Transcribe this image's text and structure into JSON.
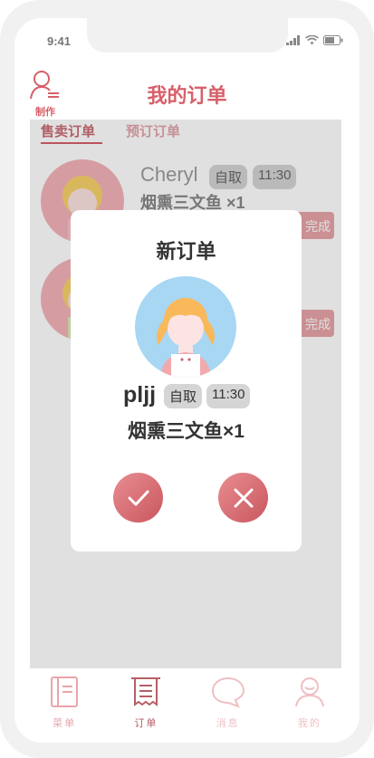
{
  "status_bar": {
    "time": "9:41"
  },
  "header": {
    "make_label": "制作",
    "title": "我的订单"
  },
  "tabs": {
    "sale": "售卖订单",
    "preorder": "预订订单"
  },
  "orders": [
    {
      "name": "Cheryl",
      "pickup": "自取",
      "time": "11:30",
      "dish": "烟熏三文鱼 ×1",
      "action": "完成"
    },
    {
      "name": "",
      "pickup": "",
      "time": "",
      "dish": "",
      "action": "完成"
    }
  ],
  "modal": {
    "title": "新订单",
    "name": "pljj",
    "pickup": "自取",
    "time": "11:30",
    "dish": "烟熏三文鱼×1"
  },
  "tabbar": {
    "menu": "菜单",
    "orders": "订单",
    "messages": "消息",
    "me": "我的"
  },
  "colors": {
    "accent": "#d7606a",
    "avatar_bg": "#a7d7f3"
  },
  "icons": [
    "chef-icon",
    "check-icon",
    "close-icon",
    "menu-book-icon",
    "receipt-icon",
    "message-icon",
    "user-icon"
  ]
}
